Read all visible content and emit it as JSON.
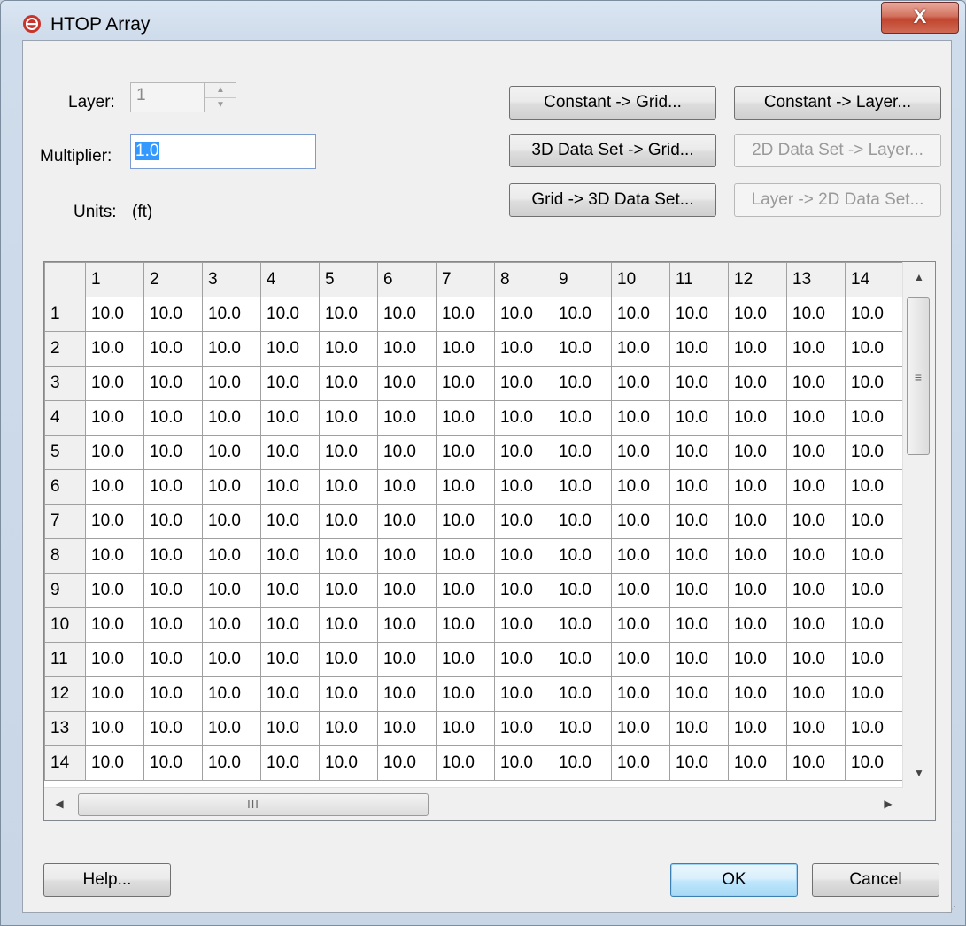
{
  "window": {
    "title": "HTOP Array",
    "close_label": "X"
  },
  "form": {
    "layer_label": "Layer:",
    "layer_value": "1",
    "multiplier_label": "Multiplier:",
    "multiplier_value": "1.0",
    "units_label": "Units:",
    "units_value": "(ft)"
  },
  "buttons": {
    "constant_grid": "Constant -> Grid...",
    "constant_layer": "Constant -> Layer...",
    "dataset3d_grid": "3D Data Set -> Grid...",
    "dataset2d_layer": "2D Data Set -> Layer...",
    "grid_dataset3d": "Grid -> 3D Data Set...",
    "layer_dataset2d": "Layer -> 2D Data Set...",
    "help": "Help...",
    "ok": "OK",
    "cancel": "Cancel"
  },
  "grid": {
    "columns": [
      "1",
      "2",
      "3",
      "4",
      "5",
      "6",
      "7",
      "8",
      "9",
      "10",
      "11",
      "12",
      "13",
      "14"
    ],
    "rows": [
      {
        "label": "1",
        "cells": [
          "10.0",
          "10.0",
          "10.0",
          "10.0",
          "10.0",
          "10.0",
          "10.0",
          "10.0",
          "10.0",
          "10.0",
          "10.0",
          "10.0",
          "10.0",
          "10.0"
        ]
      },
      {
        "label": "2",
        "cells": [
          "10.0",
          "10.0",
          "10.0",
          "10.0",
          "10.0",
          "10.0",
          "10.0",
          "10.0",
          "10.0",
          "10.0",
          "10.0",
          "10.0",
          "10.0",
          "10.0"
        ]
      },
      {
        "label": "3",
        "cells": [
          "10.0",
          "10.0",
          "10.0",
          "10.0",
          "10.0",
          "10.0",
          "10.0",
          "10.0",
          "10.0",
          "10.0",
          "10.0",
          "10.0",
          "10.0",
          "10.0"
        ]
      },
      {
        "label": "4",
        "cells": [
          "10.0",
          "10.0",
          "10.0",
          "10.0",
          "10.0",
          "10.0",
          "10.0",
          "10.0",
          "10.0",
          "10.0",
          "10.0",
          "10.0",
          "10.0",
          "10.0"
        ]
      },
      {
        "label": "5",
        "cells": [
          "10.0",
          "10.0",
          "10.0",
          "10.0",
          "10.0",
          "10.0",
          "10.0",
          "10.0",
          "10.0",
          "10.0",
          "10.0",
          "10.0",
          "10.0",
          "10.0"
        ]
      },
      {
        "label": "6",
        "cells": [
          "10.0",
          "10.0",
          "10.0",
          "10.0",
          "10.0",
          "10.0",
          "10.0",
          "10.0",
          "10.0",
          "10.0",
          "10.0",
          "10.0",
          "10.0",
          "10.0"
        ]
      },
      {
        "label": "7",
        "cells": [
          "10.0",
          "10.0",
          "10.0",
          "10.0",
          "10.0",
          "10.0",
          "10.0",
          "10.0",
          "10.0",
          "10.0",
          "10.0",
          "10.0",
          "10.0",
          "10.0"
        ]
      },
      {
        "label": "8",
        "cells": [
          "10.0",
          "10.0",
          "10.0",
          "10.0",
          "10.0",
          "10.0",
          "10.0",
          "10.0",
          "10.0",
          "10.0",
          "10.0",
          "10.0",
          "10.0",
          "10.0"
        ]
      },
      {
        "label": "9",
        "cells": [
          "10.0",
          "10.0",
          "10.0",
          "10.0",
          "10.0",
          "10.0",
          "10.0",
          "10.0",
          "10.0",
          "10.0",
          "10.0",
          "10.0",
          "10.0",
          "10.0"
        ]
      },
      {
        "label": "10",
        "cells": [
          "10.0",
          "10.0",
          "10.0",
          "10.0",
          "10.0",
          "10.0",
          "10.0",
          "10.0",
          "10.0",
          "10.0",
          "10.0",
          "10.0",
          "10.0",
          "10.0"
        ]
      },
      {
        "label": "11",
        "cells": [
          "10.0",
          "10.0",
          "10.0",
          "10.0",
          "10.0",
          "10.0",
          "10.0",
          "10.0",
          "10.0",
          "10.0",
          "10.0",
          "10.0",
          "10.0",
          "10.0"
        ]
      },
      {
        "label": "12",
        "cells": [
          "10.0",
          "10.0",
          "10.0",
          "10.0",
          "10.0",
          "10.0",
          "10.0",
          "10.0",
          "10.0",
          "10.0",
          "10.0",
          "10.0",
          "10.0",
          "10.0"
        ]
      },
      {
        "label": "13",
        "cells": [
          "10.0",
          "10.0",
          "10.0",
          "10.0",
          "10.0",
          "10.0",
          "10.0",
          "10.0",
          "10.0",
          "10.0",
          "10.0",
          "10.0",
          "10.0",
          "10.0"
        ]
      },
      {
        "label": "14",
        "cells": [
          "10.0",
          "10.0",
          "10.0",
          "10.0",
          "10.0",
          "10.0",
          "10.0",
          "10.0",
          "10.0",
          "10.0",
          "10.0",
          "10.0",
          "10.0",
          "10.0"
        ]
      }
    ]
  },
  "colors": {
    "title_icon": "#c8332b",
    "selection": "#3399ff",
    "close_button": "#c2452f"
  },
  "icons": {
    "app": "htop-app-icon",
    "close": "close-icon",
    "spin_up": "spin-up-icon",
    "spin_down": "spin-down-icon"
  }
}
